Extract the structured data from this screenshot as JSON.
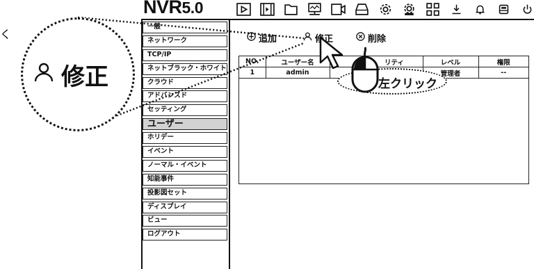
{
  "app": {
    "logo_main": "NVR",
    "logo_version": "5.0"
  },
  "toolbar": {
    "icons": [
      "play-icon",
      "playback-icon",
      "folder-icon",
      "network-icon",
      "record-icon",
      "storage-icon",
      "settings-icon",
      "system-icon",
      "grid-icon",
      "download-icon",
      "alarm-icon",
      "disk-icon",
      "power-icon"
    ]
  },
  "sidebar": {
    "items": [
      {
        "label": "一般"
      },
      {
        "label": "ネットワーク"
      },
      {
        "label": "TCP/IP"
      },
      {
        "label": "ネットブラック・ホワイトリ…"
      },
      {
        "label": "クラウド"
      },
      {
        "label": "アドバンスド"
      },
      {
        "label": "セッティング"
      },
      {
        "label": "ユーザー",
        "active": true
      },
      {
        "label": "ホリデー"
      },
      {
        "label": "イベント"
      },
      {
        "label": "ノーマル・イベント"
      },
      {
        "label": "知能事件"
      },
      {
        "label": "投影図セット"
      },
      {
        "label": "ディスプレイ"
      },
      {
        "label": "ビュー"
      },
      {
        "label": "ログアウト"
      }
    ]
  },
  "actions": {
    "add": "追加",
    "edit": "修正",
    "delete": "削除"
  },
  "table": {
    "headers": [
      "NO.",
      "ユーザー名",
      "",
      "リティ",
      "レベル",
      "権限"
    ],
    "rows": [
      [
        "1",
        "admin",
        "",
        "",
        "管理者",
        "--"
      ]
    ]
  },
  "callouts": {
    "zoom_label": "修正",
    "click_hint": "左クリック",
    "side_char": "く"
  }
}
